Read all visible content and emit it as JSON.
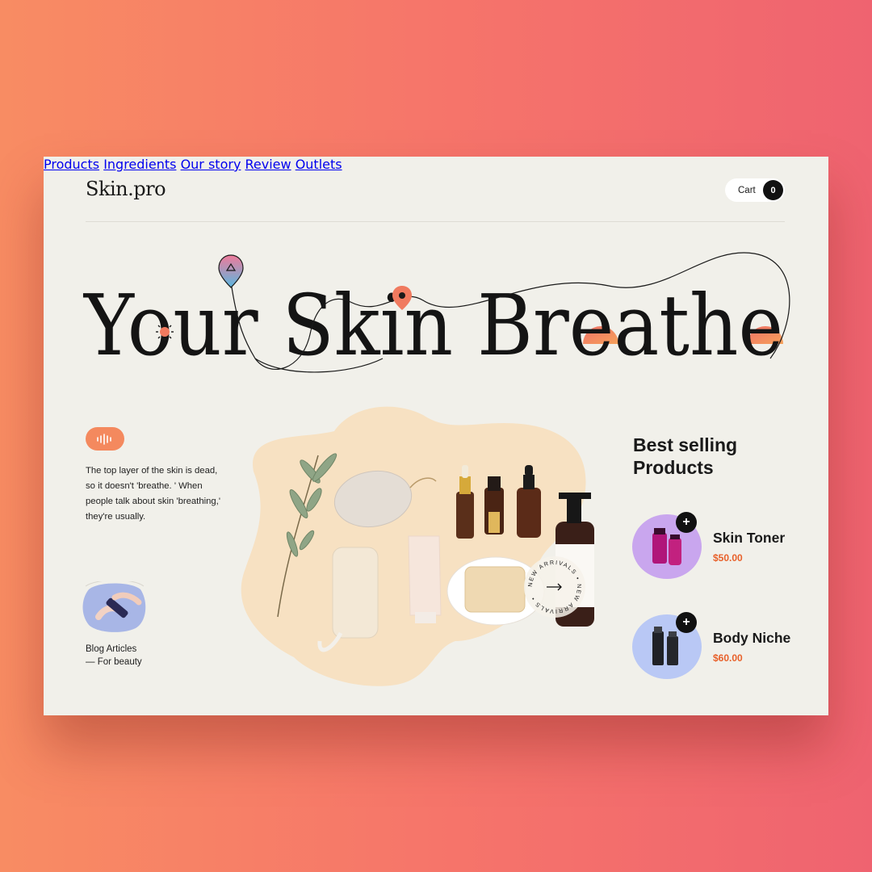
{
  "header": {
    "logo": "Skin.pro",
    "nav": [
      "Products",
      "Ingredients",
      "Our story",
      "Review",
      "Outlets"
    ],
    "cart_label": "Cart",
    "cart_count": "0"
  },
  "hero": {
    "headline": "Your Skin Breathe"
  },
  "intro": {
    "description": "The top layer of the skin is dead, so it doesn't 'breathe. ' When people talk about skin 'breathing,' they're usually."
  },
  "blog": {
    "title": "Blog Articles",
    "subtitle": "— For beauty"
  },
  "badge": {
    "text": "NEW ARRIVALS • NEW ARRIVALS •"
  },
  "best_selling": {
    "title": "Best selling Products",
    "items": [
      {
        "name": "Skin Toner",
        "price": "$50.00",
        "icon": "toner-bottles-icon"
      },
      {
        "name": "Body Niche",
        "price": "$60.00",
        "icon": "niche-bottles-icon"
      }
    ]
  },
  "colors": {
    "accent": "#f4895e",
    "price": "#e8602a",
    "card_bg": "#f1f0ea",
    "toner_bg": "#c9a6ee",
    "niche_bg": "#b9c8f5"
  }
}
